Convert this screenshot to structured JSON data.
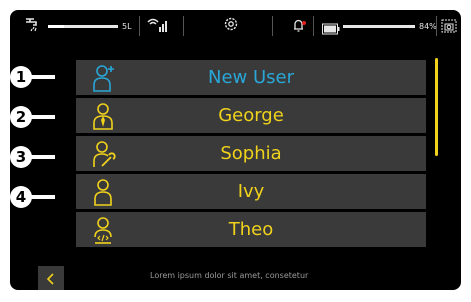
{
  "status_bar": {
    "water_level_label": "5L",
    "battery_percent_label": "84%",
    "icons": [
      "tap-icon",
      "wifi-signal-icon",
      "settings-gear-icon",
      "notification-bell-icon",
      "battery-icon",
      "camera-icon"
    ]
  },
  "users": [
    {
      "callout": "1",
      "name": "New User",
      "icon": "add-user-icon"
    },
    {
      "callout": "2",
      "name": "George",
      "icon": "user-tie-icon"
    },
    {
      "callout": "3",
      "name": "Sophia",
      "icon": "user-wrench-icon"
    },
    {
      "callout": "4",
      "name": "Ivy",
      "icon": "user-icon"
    },
    {
      "callout": "",
      "name": "Theo",
      "icon": "user-code-icon"
    }
  ],
  "footer": {
    "text": "Lorem ipsum dolor sit amet, consetetur"
  },
  "colors": {
    "accent_yellow": "#f0d21c",
    "new_user_blue": "#29a7d8",
    "row_background": "#3a3a3a",
    "screen_background": "#000000"
  }
}
